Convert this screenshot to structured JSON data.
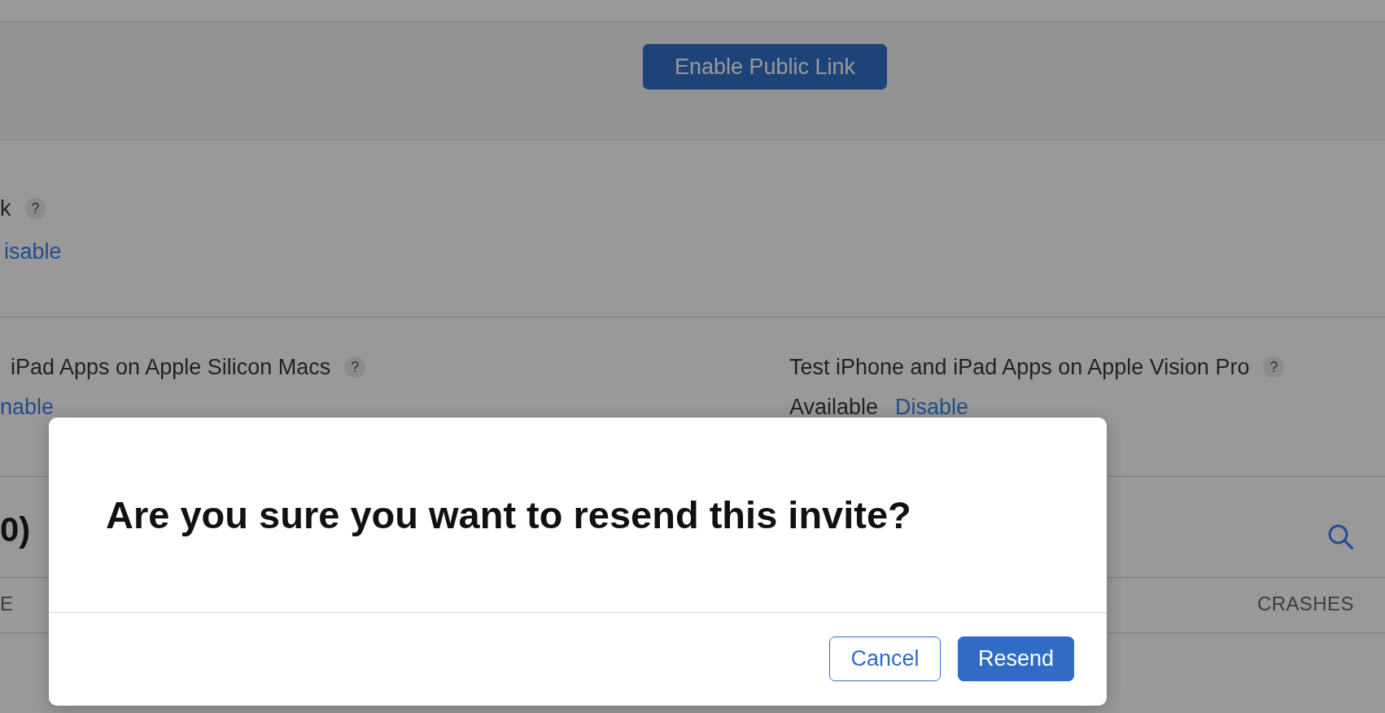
{
  "public_link_header": {
    "button": "Enable Public Link"
  },
  "public_link_setting": {
    "title": "k",
    "help": "?",
    "link": "isable"
  },
  "test_settings": [
    {
      "title": "iPad Apps on Apple Silicon Macs",
      "help": "?",
      "link": "nable"
    },
    {
      "title": "Test iPhone and iPad Apps on Apple Vision Pro",
      "help": "?",
      "status": "Available",
      "link": "Disable"
    }
  ],
  "testers_section": {
    "title": "0)"
  },
  "table": {
    "columns": [
      "E",
      "CRASHES"
    ]
  },
  "dialog": {
    "title": "Are you sure you want to resend this invite?",
    "buttons": [
      {
        "label": "Cancel",
        "kind": "secondary"
      },
      {
        "label": "Resend",
        "kind": "primary"
      }
    ]
  }
}
